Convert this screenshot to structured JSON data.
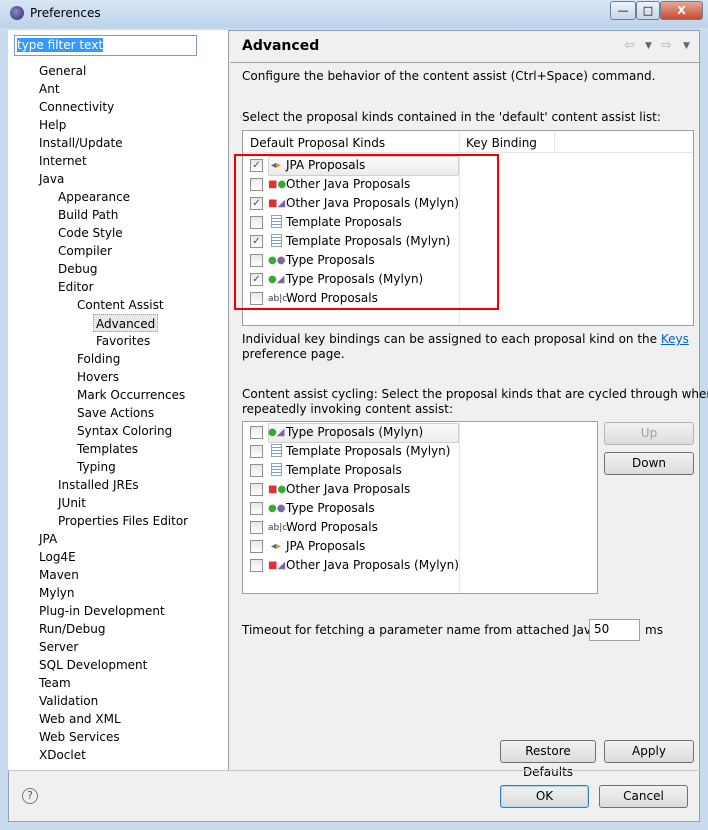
{
  "window": {
    "title": "Preferences",
    "minimize": "—",
    "maximize": "□",
    "close": "X"
  },
  "filter": {
    "value": "type filter text"
  },
  "tree": [
    {
      "label": "General",
      "level": 0
    },
    {
      "label": "Ant",
      "level": 0
    },
    {
      "label": "Connectivity",
      "level": 0
    },
    {
      "label": "Help",
      "level": 0
    },
    {
      "label": "Install/Update",
      "level": 0
    },
    {
      "label": "Internet",
      "level": 0
    },
    {
      "label": "Java",
      "level": 0
    },
    {
      "label": "Appearance",
      "level": 1
    },
    {
      "label": "Build Path",
      "level": 1
    },
    {
      "label": "Code Style",
      "level": 1
    },
    {
      "label": "Compiler",
      "level": 1
    },
    {
      "label": "Debug",
      "level": 1
    },
    {
      "label": "Editor",
      "level": 1
    },
    {
      "label": "Content Assist",
      "level": 2
    },
    {
      "label": "Advanced",
      "level": 3,
      "selected": true
    },
    {
      "label": "Favorites",
      "level": 3
    },
    {
      "label": "Folding",
      "level": 2
    },
    {
      "label": "Hovers",
      "level": 2
    },
    {
      "label": "Mark Occurrences",
      "level": 2
    },
    {
      "label": "Save Actions",
      "level": 2
    },
    {
      "label": "Syntax Coloring",
      "level": 2
    },
    {
      "label": "Templates",
      "level": 2
    },
    {
      "label": "Typing",
      "level": 2
    },
    {
      "label": "Installed JREs",
      "level": 1
    },
    {
      "label": "JUnit",
      "level": 1
    },
    {
      "label": "Properties Files Editor",
      "level": 1
    },
    {
      "label": "JPA",
      "level": 0
    },
    {
      "label": "Log4E",
      "level": 0
    },
    {
      "label": "Maven",
      "level": 0
    },
    {
      "label": "Mylyn",
      "level": 0
    },
    {
      "label": "Plug-in Development",
      "level": 0
    },
    {
      "label": "Run/Debug",
      "level": 0
    },
    {
      "label": "Server",
      "level": 0
    },
    {
      "label": "SQL Development",
      "level": 0
    },
    {
      "label": "Team",
      "level": 0
    },
    {
      "label": "Validation",
      "level": 0
    },
    {
      "label": "Web and XML",
      "level": 0
    },
    {
      "label": "Web Services",
      "level": 0
    },
    {
      "label": "XDoclet",
      "level": 0
    }
  ],
  "page": {
    "title": "Advanced",
    "description": "Configure the behavior of the content assist (Ctrl+Space) command.",
    "list1_label": "Select the proposal kinds contained in the 'default' content assist list:",
    "col1": "Default Proposal Kinds",
    "col2": "Key Binding",
    "list1": [
      {
        "label": "JPA Proposals",
        "checked": true,
        "icon": "jpa-icon"
      },
      {
        "label": "Other Java Proposals",
        "checked": false,
        "icon": "other-java-icon"
      },
      {
        "label": "Other Java Proposals (Mylyn)",
        "checked": true,
        "icon": "other-java-mylyn-icon"
      },
      {
        "label": "Template Proposals",
        "checked": false,
        "icon": "template-icon"
      },
      {
        "label": "Template Proposals (Mylyn)",
        "checked": true,
        "icon": "template-icon"
      },
      {
        "label": "Type Proposals",
        "checked": false,
        "icon": "type-icon"
      },
      {
        "label": "Type Proposals (Mylyn)",
        "checked": true,
        "icon": "type-mylyn-icon"
      },
      {
        "label": "Word Proposals",
        "checked": false,
        "icon": "word-icon"
      }
    ],
    "keys_note_1": "Individual key bindings can be assigned to each proposal kind on the ",
    "keys_link": "Keys",
    "keys_note_2": "preference page.",
    "cycling_label_1": "Content assist cycling: Select the proposal kinds that are cycled through when",
    "cycling_label_2": "repeatedly invoking content assist:",
    "list2": [
      {
        "label": "Type Proposals (Mylyn)",
        "checked": false,
        "icon": "type-mylyn-icon"
      },
      {
        "label": "Template Proposals (Mylyn)",
        "checked": false,
        "icon": "template-icon"
      },
      {
        "label": "Template Proposals",
        "checked": false,
        "icon": "template-icon"
      },
      {
        "label": "Other Java Proposals",
        "checked": false,
        "icon": "other-java-icon"
      },
      {
        "label": "Type Proposals",
        "checked": false,
        "icon": "type-icon"
      },
      {
        "label": "Word Proposals",
        "checked": false,
        "icon": "word-icon"
      },
      {
        "label": "JPA Proposals",
        "checked": false,
        "icon": "jpa-icon"
      },
      {
        "label": "Other Java Proposals (Mylyn)",
        "checked": false,
        "icon": "other-java-mylyn-icon"
      }
    ],
    "up": "Up",
    "down": "Down",
    "timeout_label": "Timeout for fetching a parameter name from attached Javadoc:",
    "timeout_value": "50",
    "timeout_unit": "ms",
    "restore": "Restore Defaults",
    "apply": "Apply"
  },
  "footer": {
    "ok": "OK",
    "cancel": "Cancel",
    "help": "?"
  },
  "colors": {
    "highlight": "#ff0000",
    "link": "#0066cc"
  }
}
